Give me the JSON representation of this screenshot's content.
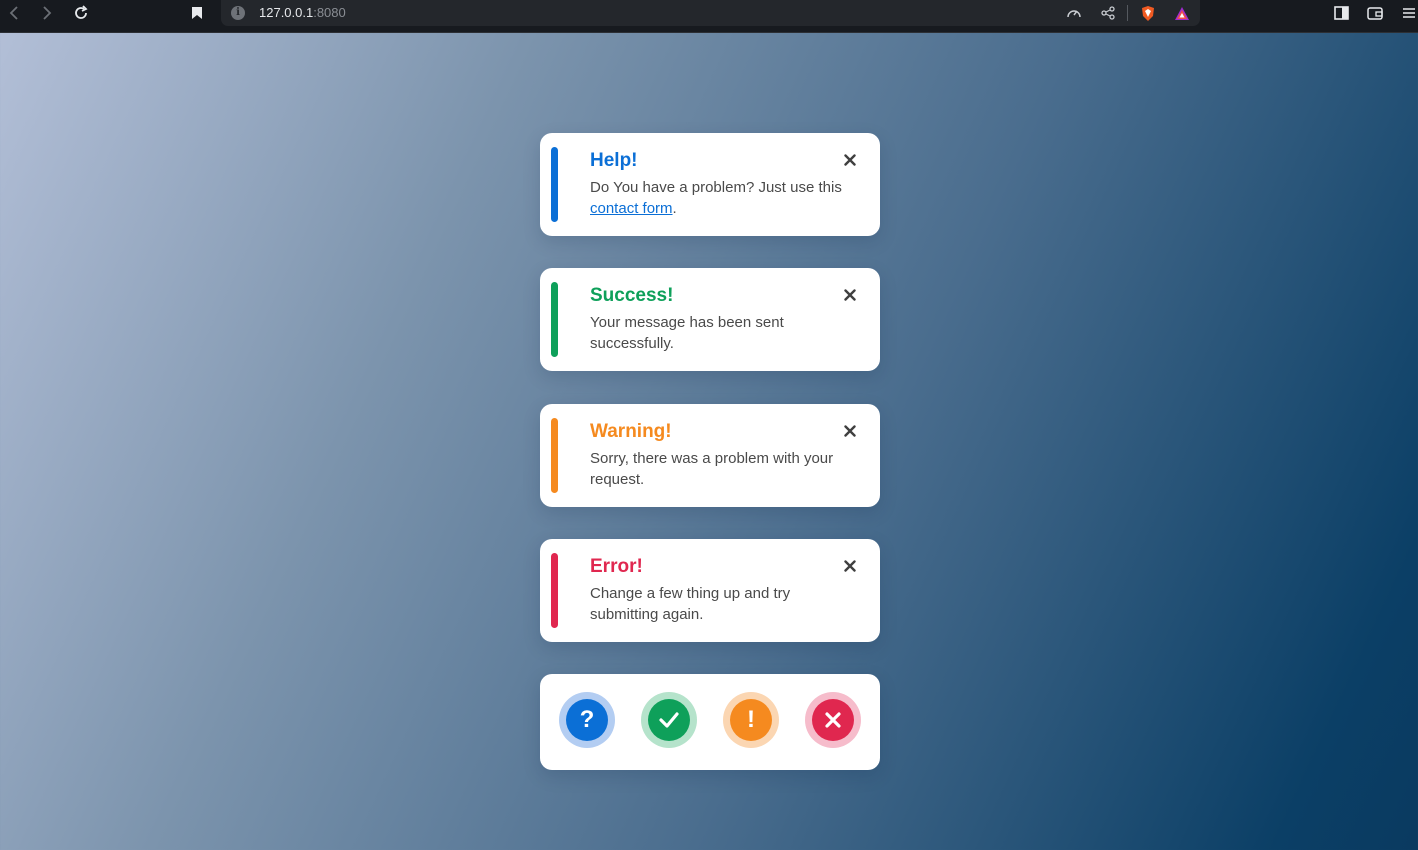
{
  "browser": {
    "url_host": "127.0.0.1",
    "url_port": ":8080"
  },
  "alerts": [
    {
      "title": "Help!",
      "message_before": "Do You have a problem? Just use this ",
      "link_text": "contact form",
      "message_after": ".",
      "color": "#0b6fd6"
    },
    {
      "title": "Success!",
      "message": "Your message has been sent successfully.",
      "color": "#0ea05a"
    },
    {
      "title": "Warning!",
      "message": "Sorry, there was a problem with your request.",
      "color": "#f58a1f"
    },
    {
      "title": "Error!",
      "message": "Change a few thing up and try submitting again.",
      "color": "#e0274f"
    }
  ],
  "icon_buttons": [
    {
      "icon": "question-icon",
      "glyph": "?",
      "color": "#0b6fd6",
      "halo": "#b3cdf2"
    },
    {
      "icon": "check-icon",
      "color": "#0ea05a",
      "halo": "#b5e3cb"
    },
    {
      "icon": "exclamation-icon",
      "glyph": "!",
      "color": "#f58a1f",
      "halo": "#fbd6b2"
    },
    {
      "icon": "x-icon",
      "color": "#e0274f",
      "halo": "#f6bccb"
    }
  ]
}
